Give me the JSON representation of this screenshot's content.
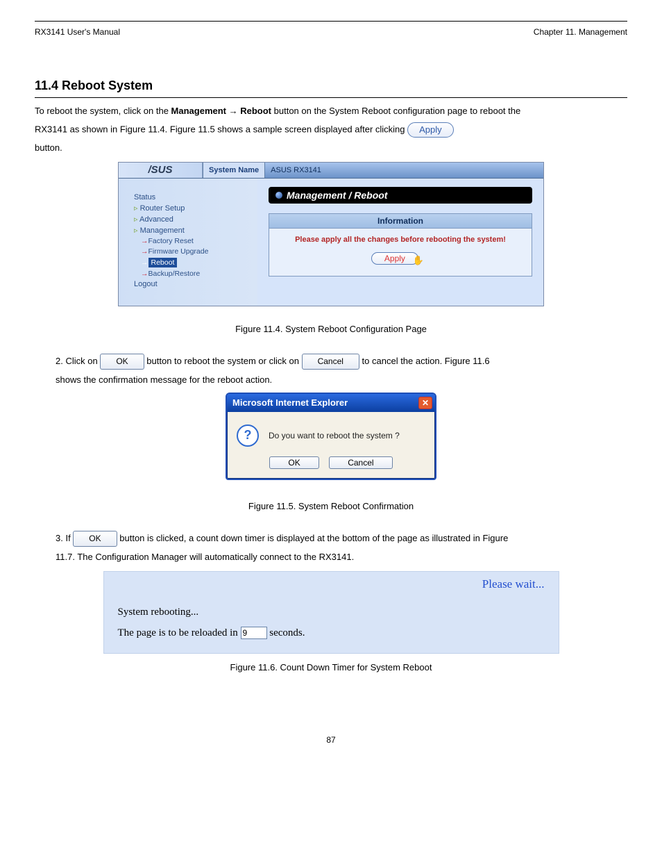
{
  "doc": {
    "header_left": "RX3141 User's Manual",
    "header_right": "Chapter 11. Management"
  },
  "sec": {
    "title": "11.4 Reboot System",
    "p0_pre": "To reboot the system, click on the ",
    "p0_post": " button on the System Reboot configuration page to reboot the",
    "p0_nav_seq": "Management → Reboot",
    "p1": "RX3141 as shown in Figure 11.4. Figure 11.5 shows a sample screen displayed after clicking ",
    "p2": "button.",
    "apply_label": "Apply",
    "step2_a": "2.  Click on ",
    "step2_b": " button to reboot the system or click on ",
    "step2_c": " to cancel the action. Figure 11.6",
    "step3": "shows the confirmation message for the reboot action.",
    "ok_label": "OK",
    "cancel_label": "Cancel",
    "fig4": "Figure 11.4. System Reboot Configuration Page",
    "fig5": "Figure 11.5. System Reboot Confirmation",
    "step4_a": "3.  If ",
    "step4_b": " button is clicked, a count down timer is displayed at the bottom of the page as illustrated in Figure",
    "step5": "11.7. The Configuration Manager will automatically connect to the RX3141.",
    "fig7": "Figure 11.6. Count Down Timer for System Reboot",
    "page_num": "87"
  },
  "shot": {
    "logo": "/SUS",
    "sysname_lbl": "System Name",
    "sysname_val": "ASUS RX3141",
    "sidebar": {
      "status": "Status",
      "router": "Router Setup",
      "adv": "Advanced",
      "mgmt": "Management",
      "factory": "Factory Reset",
      "fw": "Firmware Upgrade",
      "reboot": "Reboot",
      "br": "Backup/Restore",
      "logout": "Logout"
    },
    "content_title": "Management / Reboot",
    "info_head": "Information",
    "info_text": "Please apply all the changes before rebooting the system!",
    "mini_apply": "Apply"
  },
  "dlg": {
    "title": "Microsoft Internet Explorer",
    "msg": "Do you want to reboot the system ?",
    "ok": "OK",
    "cancel": "Cancel"
  },
  "wait": {
    "pw": "Please wait...",
    "l1": "System rebooting...",
    "l2a": "The page is to be reloaded in ",
    "l2b": " seconds.",
    "sec": "9"
  }
}
